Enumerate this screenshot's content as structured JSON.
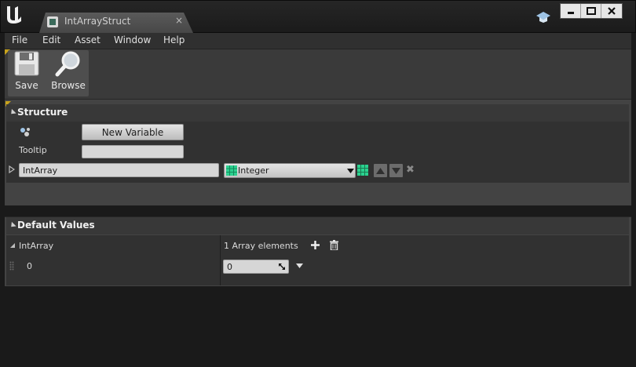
{
  "window": {
    "tab_title": "IntArrayStruct",
    "tab_close": "×"
  },
  "menu": {
    "items": [
      "File",
      "Edit",
      "Asset",
      "Window",
      "Help"
    ]
  },
  "toolbar": {
    "save_label": "Save",
    "browse_label": "Browse"
  },
  "structure": {
    "header": "Structure",
    "new_variable_label": "New Variable",
    "tooltip_label": "Tooltip",
    "tooltip_value": "",
    "variable": {
      "name": "IntArray",
      "type": "Integer",
      "delete": "✖"
    }
  },
  "defaults": {
    "header": "Default Values",
    "array_name": "IntArray",
    "array_count_text": "1 Array elements",
    "element_index": "0",
    "element_value": "0"
  },
  "colors": {
    "accent": "#c8a31c",
    "panel_bg": "#434343",
    "header_bg": "#383838",
    "type_green": "#2bd18f"
  }
}
